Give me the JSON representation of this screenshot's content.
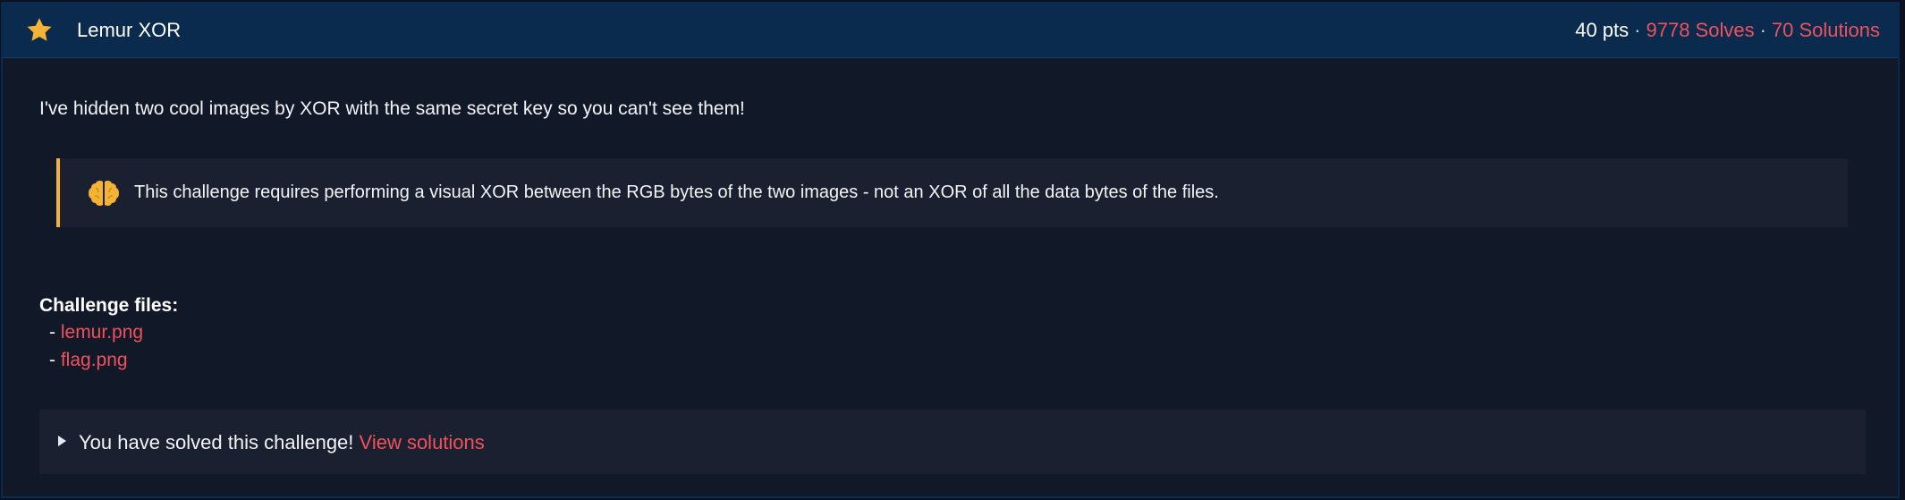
{
  "header": {
    "title": "Lemur XOR",
    "points": "40 pts",
    "solves": "9778 Solves",
    "solutions": "70 Solutions",
    "separator": "·",
    "icon": "star-icon",
    "icon_color": "#f5b335"
  },
  "description": "I've hidden two cool images by XOR with the same secret key so you can't see them!",
  "callout": {
    "icon": "brain-icon",
    "text": "This challenge requires performing a visual XOR between the RGB bytes of the two images - not an XOR of all the data bytes of the files.",
    "accent_color": "#f5b335"
  },
  "files": {
    "heading": "Challenge files:",
    "bullet": "-",
    "items": [
      {
        "name": "lemur.png"
      },
      {
        "name": "flag.png"
      }
    ]
  },
  "solved": {
    "message": "You have solved this challenge!",
    "link": "View solutions"
  },
  "colors": {
    "link": "#f0525d",
    "header_bg": "#0a2a4e",
    "panel_bg": "#111827"
  }
}
